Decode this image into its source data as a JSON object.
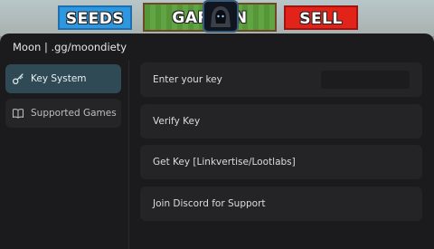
{
  "game": {
    "seeds_label": "SEEDS",
    "garden_label": "GARDEN",
    "sell_label": "SELL"
  },
  "window": {
    "title": "Moon | .gg/moondiety"
  },
  "sidebar": {
    "items": [
      {
        "label": "Key System",
        "icon": "key-icon",
        "active": true
      },
      {
        "label": "Supported Games",
        "icon": "book-icon",
        "active": false
      }
    ]
  },
  "main": {
    "rows": [
      {
        "label": "Enter your key",
        "input_value": "",
        "input_placeholder": ""
      },
      {
        "label": "Verify Key"
      },
      {
        "label": "Get Key [Linkvertise/Lootlabs]"
      },
      {
        "label": "Join Discord for Support"
      }
    ]
  },
  "colors": {
    "panel_bg": "#1b1b1d",
    "row_bg": "#242427",
    "active_tab_bg": "#2f4a54",
    "seeds_blue": "#2e97e0",
    "sell_red": "#e2231a",
    "garden_green": "#5aa03b"
  }
}
